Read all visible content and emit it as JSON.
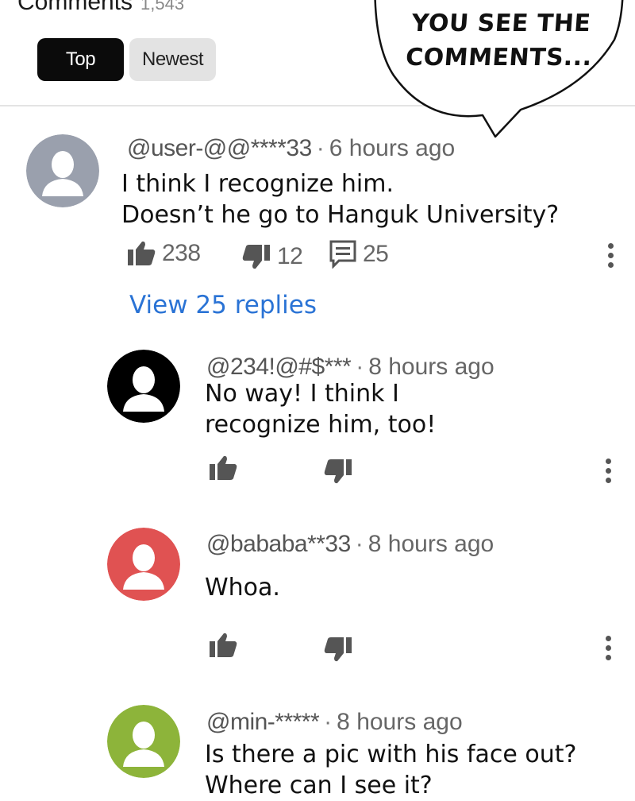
{
  "header": {
    "title": "Comments",
    "count": "1,543"
  },
  "filters": {
    "top_label": "Top",
    "newest_label": "Newest"
  },
  "bubble": {
    "line1": "YOU SEE THE",
    "line2": "COMMENTS..."
  },
  "comment": {
    "handle": "@user-@@****33",
    "time": "6 hours ago",
    "line1": "I think I recognize him.",
    "line2": "Doesn’t he go to Hanguk University?",
    "likes": "238",
    "dislikes": "12",
    "replies_count": "25",
    "view_replies": "View 25 replies",
    "avatar_color": "#9aa0ad"
  },
  "replies": [
    {
      "handle": "@234!@#$***",
      "time": "8 hours ago",
      "line1": "No way! I think I",
      "line2": "recognize him, too!",
      "avatar_color": "#000000"
    },
    {
      "handle": "@bababa**33",
      "time": "8 hours ago",
      "line1": "Whoa.",
      "line2": "",
      "avatar_color": "#e05252"
    },
    {
      "handle": "@min-*****",
      "time": "8 hours ago",
      "line1": "Is there a pic with his face out?",
      "line2": "Where can I see it?",
      "avatar_color": "#8db43a"
    }
  ],
  "icons": {
    "like": "thumbs-up-icon",
    "dislike": "thumbs-down-icon",
    "reply": "comment-icon",
    "more": "more-vertical-icon"
  }
}
